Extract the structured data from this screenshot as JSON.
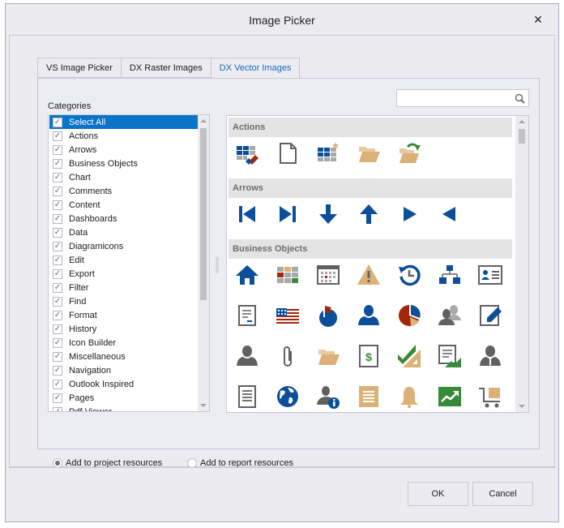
{
  "window": {
    "title": "Image Picker",
    "close_glyph": "✕"
  },
  "tabs": [
    {
      "label": "VS Image Picker",
      "active": false
    },
    {
      "label": "DX Raster Images",
      "active": false
    },
    {
      "label": "DX Vector Images",
      "active": true
    }
  ],
  "categories": {
    "label": "Categories",
    "items": [
      {
        "label": "Select All",
        "checked": true,
        "selected": true
      },
      {
        "label": "Actions",
        "checked": true
      },
      {
        "label": "Arrows",
        "checked": true
      },
      {
        "label": "Business Objects",
        "checked": true
      },
      {
        "label": "Chart",
        "checked": true
      },
      {
        "label": "Comments",
        "checked": true
      },
      {
        "label": "Content",
        "checked": true
      },
      {
        "label": "Dashboards",
        "checked": true
      },
      {
        "label": "Data",
        "checked": true
      },
      {
        "label": "Diagramicons",
        "checked": true
      },
      {
        "label": "Edit",
        "checked": true
      },
      {
        "label": "Export",
        "checked": true
      },
      {
        "label": "Filter",
        "checked": true
      },
      {
        "label": "Find",
        "checked": true
      },
      {
        "label": "Format",
        "checked": true
      },
      {
        "label": "History",
        "checked": true
      },
      {
        "label": "Icon Builder",
        "checked": true
      },
      {
        "label": "Miscellaneous",
        "checked": true
      },
      {
        "label": "Navigation",
        "checked": true
      },
      {
        "label": "Outlook Inspired",
        "checked": true
      },
      {
        "label": "Pages",
        "checked": true
      },
      {
        "label": "Pdf Viewer",
        "checked": true
      }
    ],
    "check_glyph": "✓"
  },
  "search": {
    "value": "",
    "placeholder": ""
  },
  "gallery": {
    "groups": [
      {
        "name": "Actions",
        "icons": [
          "clear-table-icon",
          "new-document-icon",
          "new-table-icon",
          "open-folder-icon",
          "open-folder-arrow-icon"
        ]
      },
      {
        "name": "Arrows",
        "icons": [
          "first-icon",
          "last-icon",
          "arrow-down-icon",
          "arrow-up-icon",
          "play-right-icon",
          "play-left-icon"
        ]
      },
      {
        "name": "Business Objects",
        "icons": [
          "home-icon",
          "color-grid-icon",
          "calendar-icon",
          "warning-icon",
          "history-icon",
          "org-chart-icon",
          "id-card-icon",
          "document-minus-icon",
          "us-flag-icon",
          "globe-flag-icon",
          "user-icon",
          "pie-chart-icon",
          "users-icon",
          "edit-document-icon",
          "employee-icon",
          "paperclip-icon",
          "folder-icon",
          "money-document-icon",
          "sales-triangle-icon",
          "document-chart-icon",
          "businessman-icon",
          "text-document-icon",
          "world-icon",
          "user-info-icon",
          "note-icon",
          "bell-icon",
          "trend-up-icon",
          "shopping-cart-icon"
        ]
      }
    ]
  },
  "resources": {
    "options": [
      {
        "label": "Add to project resources",
        "selected": true
      },
      {
        "label": "Add to report resources",
        "selected": false
      }
    ]
  },
  "buttons": {
    "ok": "OK",
    "cancel": "Cancel"
  },
  "colors": {
    "accent": "#0a74c9",
    "icon_blue": "#0b4f9a",
    "icon_red": "#a4260d",
    "icon_tan": "#dcb177",
    "icon_green": "#378a38",
    "icon_gray": "#616161"
  }
}
